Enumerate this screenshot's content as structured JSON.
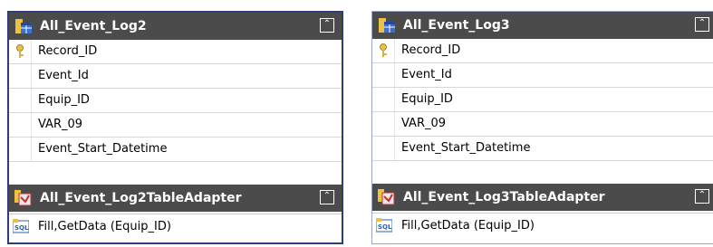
{
  "left": {
    "table": {
      "title": "All_Event_Log2",
      "icon": "table-icon",
      "columns": [
        {
          "name": "Record_ID",
          "key": true
        },
        {
          "name": "Event_Id",
          "key": false
        },
        {
          "name": "Equip_ID",
          "key": false
        },
        {
          "name": "VAR_09",
          "key": false
        },
        {
          "name": "Event_Start_Datetime",
          "key": false
        }
      ]
    },
    "adapter": {
      "title": "All_Event_Log2TableAdapter",
      "icon": "tableadapter-icon",
      "method": "Fill,GetData (Equip_ID)"
    }
  },
  "right": {
    "table": {
      "title": "All_Event_Log3",
      "icon": "table-icon",
      "columns": [
        {
          "name": "Record_ID",
          "key": true
        },
        {
          "name": "Event_Id",
          "key": false
        },
        {
          "name": "Equip_ID",
          "key": false
        },
        {
          "name": "VAR_09",
          "key": false
        },
        {
          "name": "Event_Start_Datetime",
          "key": false
        }
      ]
    },
    "adapter": {
      "title": "All_Event_Log3TableAdapter",
      "icon": "tableadapter-icon",
      "method": "Fill,GetData (Equip_ID)"
    }
  },
  "collapse_glyph": "⌃",
  "colors": {
    "header_bg": "#4b4b4b",
    "border": "#2a3f7a",
    "key_color": "#d9b04a"
  }
}
